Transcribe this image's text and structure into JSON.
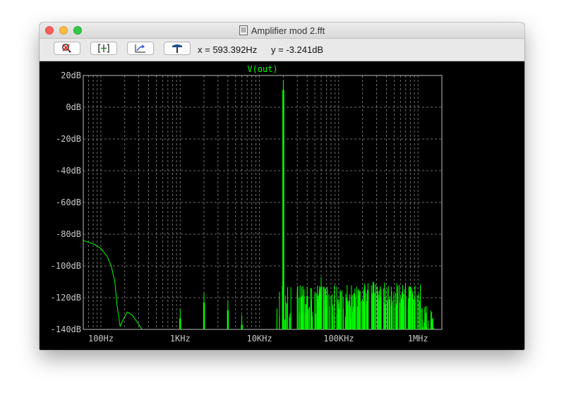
{
  "window": {
    "title": "Amplifier mod 2.fft"
  },
  "toolbar": {
    "buttons": [
      {
        "name": "autoscale-button",
        "icon": "magnifier-zoom-icon"
      },
      {
        "name": "zoom-to-fit-button",
        "icon": "fit-bracket-icon"
      },
      {
        "name": "zoom-back-button",
        "icon": "zoom-back-icon"
      },
      {
        "name": "pick-trace-button",
        "icon": "hammer-tool-icon"
      }
    ],
    "cursor_x": "x = 593.392Hz",
    "cursor_y": "y = -3.241dB"
  },
  "chart_data": {
    "type": "line",
    "title": "V(out)",
    "xlabel": "",
    "ylabel": "",
    "xscale": "log",
    "xlim": [
      60,
      2000000
    ],
    "ylim": [
      -140,
      20
    ],
    "grid": true,
    "y_ticks": [
      "20dB",
      "0dB",
      "-20dB",
      "-40dB",
      "-60dB",
      "-80dB",
      "-100dB",
      "-120dB",
      "-140dB"
    ],
    "x_ticks": [
      "100Hz",
      "1KHz",
      "10KHz",
      "100KHz",
      "1MHz"
    ],
    "trace_color": "#00ff00",
    "series": [
      {
        "name": "V(out)",
        "x": [
          60,
          80,
          100,
          120,
          135,
          150,
          160,
          175,
          190,
          215,
          250,
          330
        ],
        "y": [
          -84,
          -86,
          -89,
          -94,
          -100,
          -110,
          -125,
          -138,
          -134,
          -129,
          -131,
          -140
        ]
      }
    ],
    "peaks": [
      {
        "x": 1000,
        "y": -127
      },
      {
        "x": 2000,
        "y": -117
      },
      {
        "x": 4000,
        "y": -122
      },
      {
        "x": 6000,
        "y": -131
      },
      {
        "x": 20000,
        "y": 17
      },
      {
        "x": 40000,
        "y": -113
      },
      {
        "x": 60000,
        "y": -107
      },
      {
        "x": 100000,
        "y": -121
      },
      {
        "x": 140000,
        "y": -127
      }
    ]
  }
}
